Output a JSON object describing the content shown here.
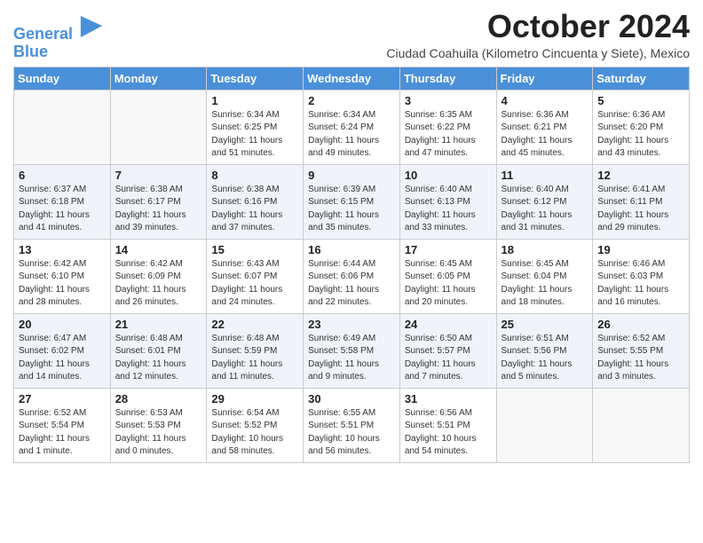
{
  "logo": {
    "line1": "General",
    "line2": "Blue"
  },
  "title": "October 2024",
  "subtitle": "Ciudad Coahuila (Kilometro Cincuenta y Siete), Mexico",
  "days_of_week": [
    "Sunday",
    "Monday",
    "Tuesday",
    "Wednesday",
    "Thursday",
    "Friday",
    "Saturday"
  ],
  "weeks": [
    [
      {
        "day": "",
        "info": ""
      },
      {
        "day": "",
        "info": ""
      },
      {
        "day": "1",
        "info": "Sunrise: 6:34 AM\nSunset: 6:25 PM\nDaylight: 11 hours and 51 minutes."
      },
      {
        "day": "2",
        "info": "Sunrise: 6:34 AM\nSunset: 6:24 PM\nDaylight: 11 hours and 49 minutes."
      },
      {
        "day": "3",
        "info": "Sunrise: 6:35 AM\nSunset: 6:22 PM\nDaylight: 11 hours and 47 minutes."
      },
      {
        "day": "4",
        "info": "Sunrise: 6:36 AM\nSunset: 6:21 PM\nDaylight: 11 hours and 45 minutes."
      },
      {
        "day": "5",
        "info": "Sunrise: 6:36 AM\nSunset: 6:20 PM\nDaylight: 11 hours and 43 minutes."
      }
    ],
    [
      {
        "day": "6",
        "info": "Sunrise: 6:37 AM\nSunset: 6:18 PM\nDaylight: 11 hours and 41 minutes."
      },
      {
        "day": "7",
        "info": "Sunrise: 6:38 AM\nSunset: 6:17 PM\nDaylight: 11 hours and 39 minutes."
      },
      {
        "day": "8",
        "info": "Sunrise: 6:38 AM\nSunset: 6:16 PM\nDaylight: 11 hours and 37 minutes."
      },
      {
        "day": "9",
        "info": "Sunrise: 6:39 AM\nSunset: 6:15 PM\nDaylight: 11 hours and 35 minutes."
      },
      {
        "day": "10",
        "info": "Sunrise: 6:40 AM\nSunset: 6:13 PM\nDaylight: 11 hours and 33 minutes."
      },
      {
        "day": "11",
        "info": "Sunrise: 6:40 AM\nSunset: 6:12 PM\nDaylight: 11 hours and 31 minutes."
      },
      {
        "day": "12",
        "info": "Sunrise: 6:41 AM\nSunset: 6:11 PM\nDaylight: 11 hours and 29 minutes."
      }
    ],
    [
      {
        "day": "13",
        "info": "Sunrise: 6:42 AM\nSunset: 6:10 PM\nDaylight: 11 hours and 28 minutes."
      },
      {
        "day": "14",
        "info": "Sunrise: 6:42 AM\nSunset: 6:09 PM\nDaylight: 11 hours and 26 minutes."
      },
      {
        "day": "15",
        "info": "Sunrise: 6:43 AM\nSunset: 6:07 PM\nDaylight: 11 hours and 24 minutes."
      },
      {
        "day": "16",
        "info": "Sunrise: 6:44 AM\nSunset: 6:06 PM\nDaylight: 11 hours and 22 minutes."
      },
      {
        "day": "17",
        "info": "Sunrise: 6:45 AM\nSunset: 6:05 PM\nDaylight: 11 hours and 20 minutes."
      },
      {
        "day": "18",
        "info": "Sunrise: 6:45 AM\nSunset: 6:04 PM\nDaylight: 11 hours and 18 minutes."
      },
      {
        "day": "19",
        "info": "Sunrise: 6:46 AM\nSunset: 6:03 PM\nDaylight: 11 hours and 16 minutes."
      }
    ],
    [
      {
        "day": "20",
        "info": "Sunrise: 6:47 AM\nSunset: 6:02 PM\nDaylight: 11 hours and 14 minutes."
      },
      {
        "day": "21",
        "info": "Sunrise: 6:48 AM\nSunset: 6:01 PM\nDaylight: 11 hours and 12 minutes."
      },
      {
        "day": "22",
        "info": "Sunrise: 6:48 AM\nSunset: 5:59 PM\nDaylight: 11 hours and 11 minutes."
      },
      {
        "day": "23",
        "info": "Sunrise: 6:49 AM\nSunset: 5:58 PM\nDaylight: 11 hours and 9 minutes."
      },
      {
        "day": "24",
        "info": "Sunrise: 6:50 AM\nSunset: 5:57 PM\nDaylight: 11 hours and 7 minutes."
      },
      {
        "day": "25",
        "info": "Sunrise: 6:51 AM\nSunset: 5:56 PM\nDaylight: 11 hours and 5 minutes."
      },
      {
        "day": "26",
        "info": "Sunrise: 6:52 AM\nSunset: 5:55 PM\nDaylight: 11 hours and 3 minutes."
      }
    ],
    [
      {
        "day": "27",
        "info": "Sunrise: 6:52 AM\nSunset: 5:54 PM\nDaylight: 11 hours and 1 minute."
      },
      {
        "day": "28",
        "info": "Sunrise: 6:53 AM\nSunset: 5:53 PM\nDaylight: 11 hours and 0 minutes."
      },
      {
        "day": "29",
        "info": "Sunrise: 6:54 AM\nSunset: 5:52 PM\nDaylight: 10 hours and 58 minutes."
      },
      {
        "day": "30",
        "info": "Sunrise: 6:55 AM\nSunset: 5:51 PM\nDaylight: 10 hours and 56 minutes."
      },
      {
        "day": "31",
        "info": "Sunrise: 6:56 AM\nSunset: 5:51 PM\nDaylight: 10 hours and 54 minutes."
      },
      {
        "day": "",
        "info": ""
      },
      {
        "day": "",
        "info": ""
      }
    ]
  ]
}
